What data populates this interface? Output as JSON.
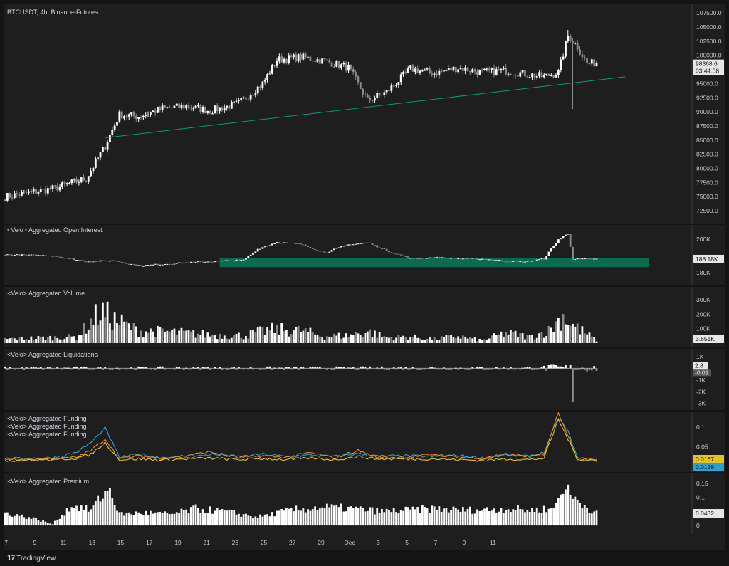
{
  "header": {
    "symbol_title": "BTCUSDT, 4h, Binance-Futures"
  },
  "footer": {
    "brand_glyph": "17",
    "brand": "TradingView"
  },
  "theme": {
    "bg": "#141414",
    "panel": "#1e1e1e",
    "up": "#ffffff",
    "down": "#8a8a8a",
    "trend": "#089981",
    "oi_zone": "#0b6b4e",
    "funding_blue": "#2aa2d6",
    "funding_orange": "#f08a1c",
    "funding_yellow": "#e8c21c"
  },
  "time_axis": {
    "labels": [
      "7",
      "9",
      "11",
      "13",
      "15",
      "17",
      "19",
      "21",
      "23",
      "25",
      "27",
      "29",
      "Dec",
      "3",
      "5",
      "7",
      "9",
      "11"
    ]
  },
  "chart_data": [
    {
      "type": "candlestick",
      "title": "BTCUSDT, 4h, Binance-Futures",
      "yticks": [
        "107500.0",
        "105000.0",
        "102500.0",
        "100000.0",
        "97500.0",
        "95000.0",
        "92500.0",
        "90000.0",
        "87500.0",
        "85000.0",
        "82500.0",
        "80000.0",
        "77500.0",
        "75000.0",
        "72500.0"
      ],
      "ylim": [
        71000,
        108400
      ],
      "anchors": [
        [
          0,
          75000
        ],
        [
          20,
          76400
        ],
        [
          34,
          78200
        ],
        [
          42,
          84000
        ],
        [
          48,
          89500
        ],
        [
          56,
          89200
        ],
        [
          66,
          90600
        ],
        [
          76,
          91000
        ],
        [
          86,
          90200
        ],
        [
          98,
          91500
        ],
        [
          108,
          95000
        ],
        [
          114,
          99200
        ],
        [
          124,
          99700
        ],
        [
          134,
          99000
        ],
        [
          144,
          97800
        ],
        [
          152,
          92000
        ],
        [
          160,
          93500
        ],
        [
          170,
          97600
        ],
        [
          180,
          96800
        ],
        [
          190,
          97800
        ],
        [
          200,
          97000
        ],
        [
          210,
          97300
        ],
        [
          218,
          96700
        ],
        [
          226,
          96200
        ],
        [
          232,
          97000
        ],
        [
          236,
          103500
        ],
        [
          240,
          101500
        ],
        [
          244,
          98500
        ],
        [
          248,
          98700
        ]
      ],
      "last_price": "98368.6",
      "countdown": "03:44:08",
      "trendline": {
        "from": [
          42,
          85400
        ],
        "to": [
          260,
          96200
        ]
      }
    },
    {
      "type": "bar",
      "title": "<Velo> Aggregated Open Interest",
      "yticks": [
        "200K",
        "180K"
      ],
      "ylim": [
        175000,
        206000
      ],
      "anchors": [
        [
          0,
          190800
        ],
        [
          20,
          190300
        ],
        [
          34,
          186800
        ],
        [
          46,
          187300
        ],
        [
          56,
          184200
        ],
        [
          70,
          185600
        ],
        [
          86,
          186800
        ],
        [
          100,
          187600
        ],
        [
          106,
          194200
        ],
        [
          114,
          198300
        ],
        [
          124,
          197000
        ],
        [
          134,
          192000
        ],
        [
          144,
          196800
        ],
        [
          152,
          198000
        ],
        [
          160,
          193200
        ],
        [
          170,
          188500
        ],
        [
          180,
          189200
        ],
        [
          190,
          188500
        ],
        [
          200,
          188300
        ],
        [
          210,
          187000
        ],
        [
          218,
          186500
        ],
        [
          226,
          188400
        ],
        [
          232,
          200000
        ],
        [
          236,
          203500
        ],
        [
          238,
          188200
        ],
        [
          248,
          188200
        ]
      ],
      "last_value": "188.18K",
      "zone": {
        "from": 90,
        "to": 270,
        "top": 188600,
        "bottom": 183400
      }
    },
    {
      "type": "bar",
      "title": "<Velo> Aggregated Volume",
      "yticks": [
        "300K",
        "200K",
        "100K"
      ],
      "ylim": [
        0,
        360000
      ],
      "anchors": [
        [
          0,
          30000
        ],
        [
          30,
          45000
        ],
        [
          40,
          230000
        ],
        [
          46,
          170000
        ],
        [
          56,
          90000
        ],
        [
          70,
          80000
        ],
        [
          86,
          60000
        ],
        [
          100,
          55000
        ],
        [
          112,
          100000
        ],
        [
          124,
          90000
        ],
        [
          134,
          50000
        ],
        [
          144,
          55000
        ],
        [
          152,
          85000
        ],
        [
          160,
          40000
        ],
        [
          170,
          45000
        ],
        [
          180,
          30000
        ],
        [
          190,
          50000
        ],
        [
          200,
          20000
        ],
        [
          210,
          75000
        ],
        [
          220,
          45000
        ],
        [
          228,
          90000
        ],
        [
          234,
          200000
        ],
        [
          238,
          130000
        ],
        [
          248,
          20000
        ]
      ],
      "last_value": "3.651K"
    },
    {
      "type": "bar",
      "title": "<Velo> Aggregated Liquidations",
      "yticks": [
        "1K",
        "0",
        "-1K",
        "-2K",
        "-3K"
      ],
      "ylim": [
        -3200,
        1300
      ],
      "tag_values": [
        "2.8",
        "-0.01"
      ]
    },
    {
      "type": "line",
      "title": "<Velo> Aggregated Funding",
      "series": [
        {
          "name": "<Velo> Aggregated Funding",
          "anchors": [
            [
              0,
              0.018
            ],
            [
              20,
              0.021
            ],
            [
              30,
              0.035
            ],
            [
              36,
              0.06
            ],
            [
              42,
              0.098
            ],
            [
              48,
              0.022
            ],
            [
              56,
              0.03
            ],
            [
              66,
              0.022
            ],
            [
              76,
              0.021
            ],
            [
              86,
              0.03
            ],
            [
              98,
              0.024
            ],
            [
              108,
              0.03
            ],
            [
              118,
              0.024
            ],
            [
              128,
              0.028
            ],
            [
              138,
              0.024
            ],
            [
              148,
              0.032
            ],
            [
              156,
              0.025
            ],
            [
              168,
              0.026
            ],
            [
              180,
              0.024
            ],
            [
              190,
              0.027
            ],
            [
              200,
              0.02
            ],
            [
              210,
              0.028
            ],
            [
              220,
              0.024
            ],
            [
              226,
              0.035
            ],
            [
              232,
              0.125
            ],
            [
              236,
              0.09
            ],
            [
              240,
              0.02
            ],
            [
              248,
              0.013
            ]
          ],
          "last_value": "0.0129"
        },
        {
          "name": "<Velo> Aggregated Funding",
          "anchors": [
            [
              0,
              0.016
            ],
            [
              20,
              0.018
            ],
            [
              30,
              0.022
            ],
            [
              36,
              0.04
            ],
            [
              42,
              0.07
            ],
            [
              48,
              0.018
            ],
            [
              56,
              0.026
            ],
            [
              66,
              0.02
            ],
            [
              76,
              0.027
            ],
            [
              86,
              0.036
            ],
            [
              98,
              0.021
            ],
            [
              108,
              0.026
            ],
            [
              118,
              0.022
            ],
            [
              128,
              0.034
            ],
            [
              138,
              0.02
            ],
            [
              148,
              0.04
            ],
            [
              156,
              0.022
            ],
            [
              168,
              0.022
            ],
            [
              180,
              0.03
            ],
            [
              190,
              0.023
            ],
            [
              200,
              0.018
            ],
            [
              210,
              0.03
            ],
            [
              220,
              0.024
            ],
            [
              226,
              0.03
            ],
            [
              232,
              0.138
            ],
            [
              236,
              0.08
            ],
            [
              240,
              0.018
            ],
            [
              248,
              0.016
            ]
          ],
          "last_value": "0.0167"
        },
        {
          "name": "<Velo> Aggregated Funding",
          "anchors": [
            [
              0,
              0.014
            ],
            [
              20,
              0.016
            ],
            [
              30,
              0.02
            ],
            [
              36,
              0.03
            ],
            [
              42,
              0.06
            ],
            [
              48,
              0.016
            ],
            [
              56,
              0.018
            ],
            [
              66,
              0.015
            ],
            [
              76,
              0.018
            ],
            [
              86,
              0.02
            ],
            [
              98,
              0.016
            ],
            [
              108,
              0.019
            ],
            [
              118,
              0.016
            ],
            [
              128,
              0.02
            ],
            [
              138,
              0.016
            ],
            [
              148,
              0.024
            ],
            [
              156,
              0.018
            ],
            [
              168,
              0.018
            ],
            [
              180,
              0.018
            ],
            [
              190,
              0.016
            ],
            [
              200,
              0.014
            ],
            [
              210,
              0.018
            ],
            [
              220,
              0.016
            ],
            [
              226,
              0.02
            ],
            [
              232,
              0.12
            ],
            [
              236,
              0.07
            ],
            [
              240,
              0.016
            ],
            [
              248,
              0.015
            ]
          ]
        }
      ],
      "yticks": [
        "0.1",
        "0.05"
      ],
      "ylim": [
        -0.005,
        0.13
      ]
    },
    {
      "type": "bar",
      "title": "<Velo> Aggregated Premium",
      "yticks": [
        "0.15",
        "0.1",
        "0.05",
        "0"
      ],
      "ylim": [
        -0.015,
        0.17
      ],
      "anchors": [
        [
          0,
          0.045
        ],
        [
          12,
          0.025
        ],
        [
          20,
          0.005
        ],
        [
          28,
          0.07
        ],
        [
          36,
          0.055
        ],
        [
          40,
          0.1
        ],
        [
          44,
          0.13
        ],
        [
          48,
          0.04
        ],
        [
          58,
          0.045
        ],
        [
          70,
          0.04
        ],
        [
          80,
          0.06
        ],
        [
          92,
          0.05
        ],
        [
          106,
          0.03
        ],
        [
          120,
          0.055
        ],
        [
          134,
          0.065
        ],
        [
          146,
          0.06
        ],
        [
          158,
          0.05
        ],
        [
          170,
          0.055
        ],
        [
          180,
          0.06
        ],
        [
          190,
          0.055
        ],
        [
          200,
          0.055
        ],
        [
          210,
          0.06
        ],
        [
          220,
          0.055
        ],
        [
          230,
          0.06
        ],
        [
          234,
          0.14
        ],
        [
          238,
          0.1
        ],
        [
          248,
          0.043
        ]
      ],
      "last_value": "0.0432"
    }
  ]
}
